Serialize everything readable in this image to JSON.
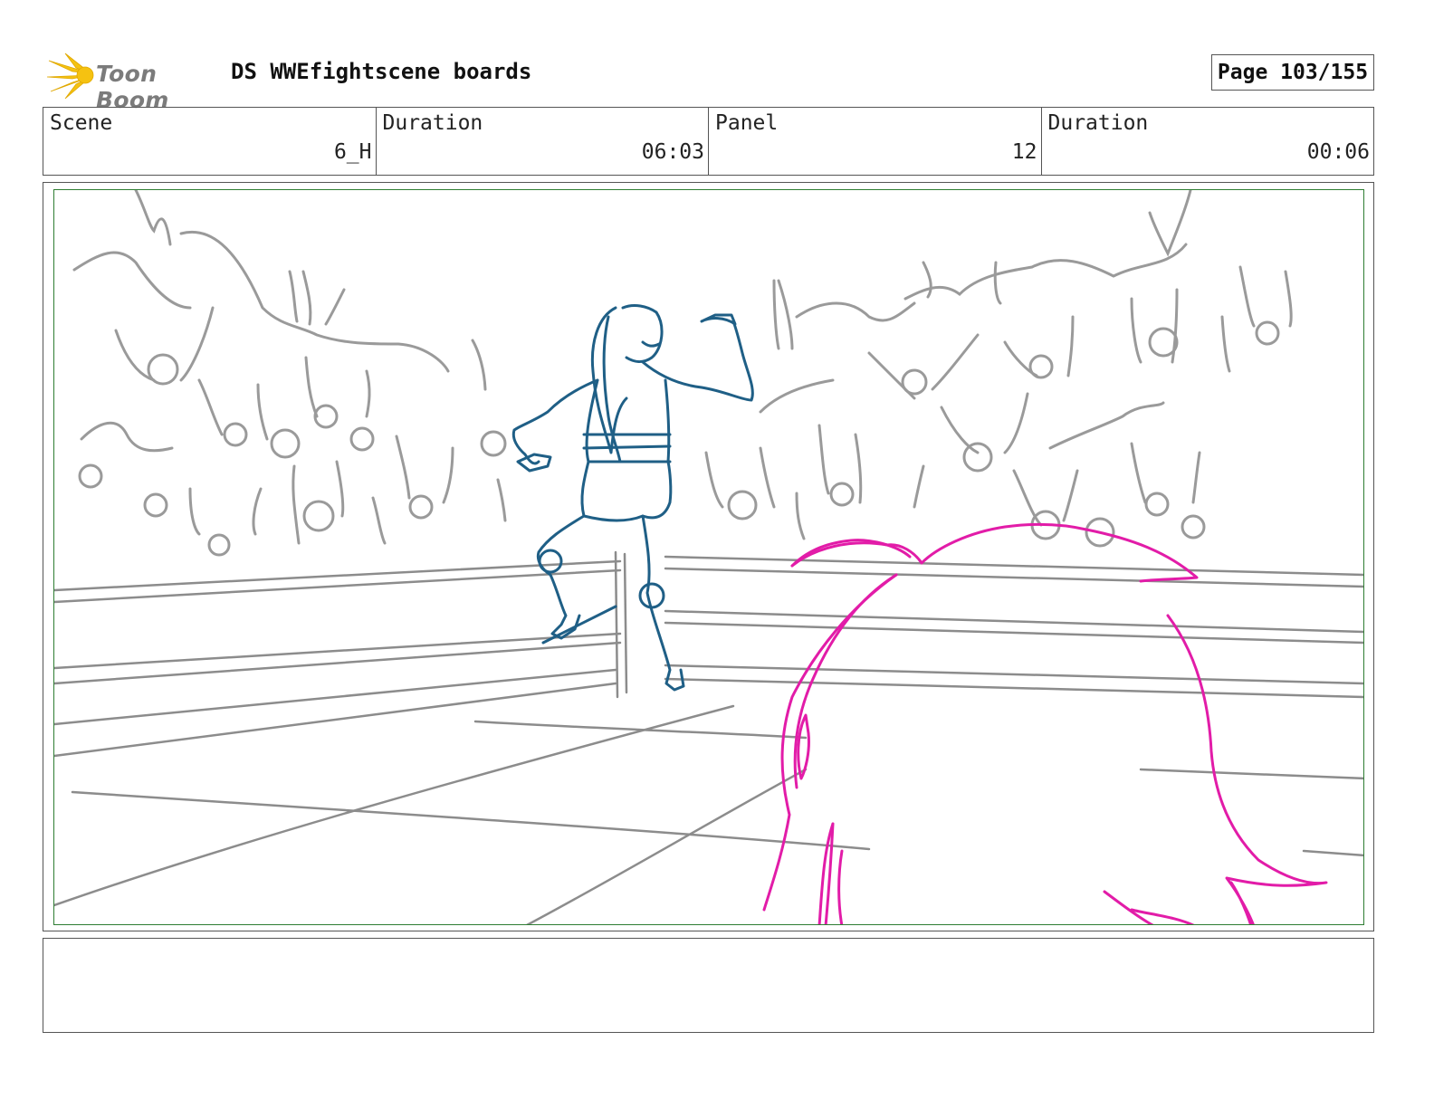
{
  "header": {
    "logo_text": "Toon Boom",
    "title": "DS WWEfightscene boards",
    "page": "Page 103/155"
  },
  "info": [
    {
      "label": "Scene",
      "value": "6_H"
    },
    {
      "label": "Duration",
      "value": "06:03"
    },
    {
      "label": "Panel",
      "value": "12"
    },
    {
      "label": "Duration",
      "value": "00:06"
    }
  ],
  "colors": {
    "crowd_lines": "#9a9a9a",
    "wrestler_lines": "#1f5f86",
    "foreground_character_lines": "#e21ca8",
    "panel_border": "#2e7d32",
    "logo_flare": "#f5c211"
  },
  "notes": ""
}
